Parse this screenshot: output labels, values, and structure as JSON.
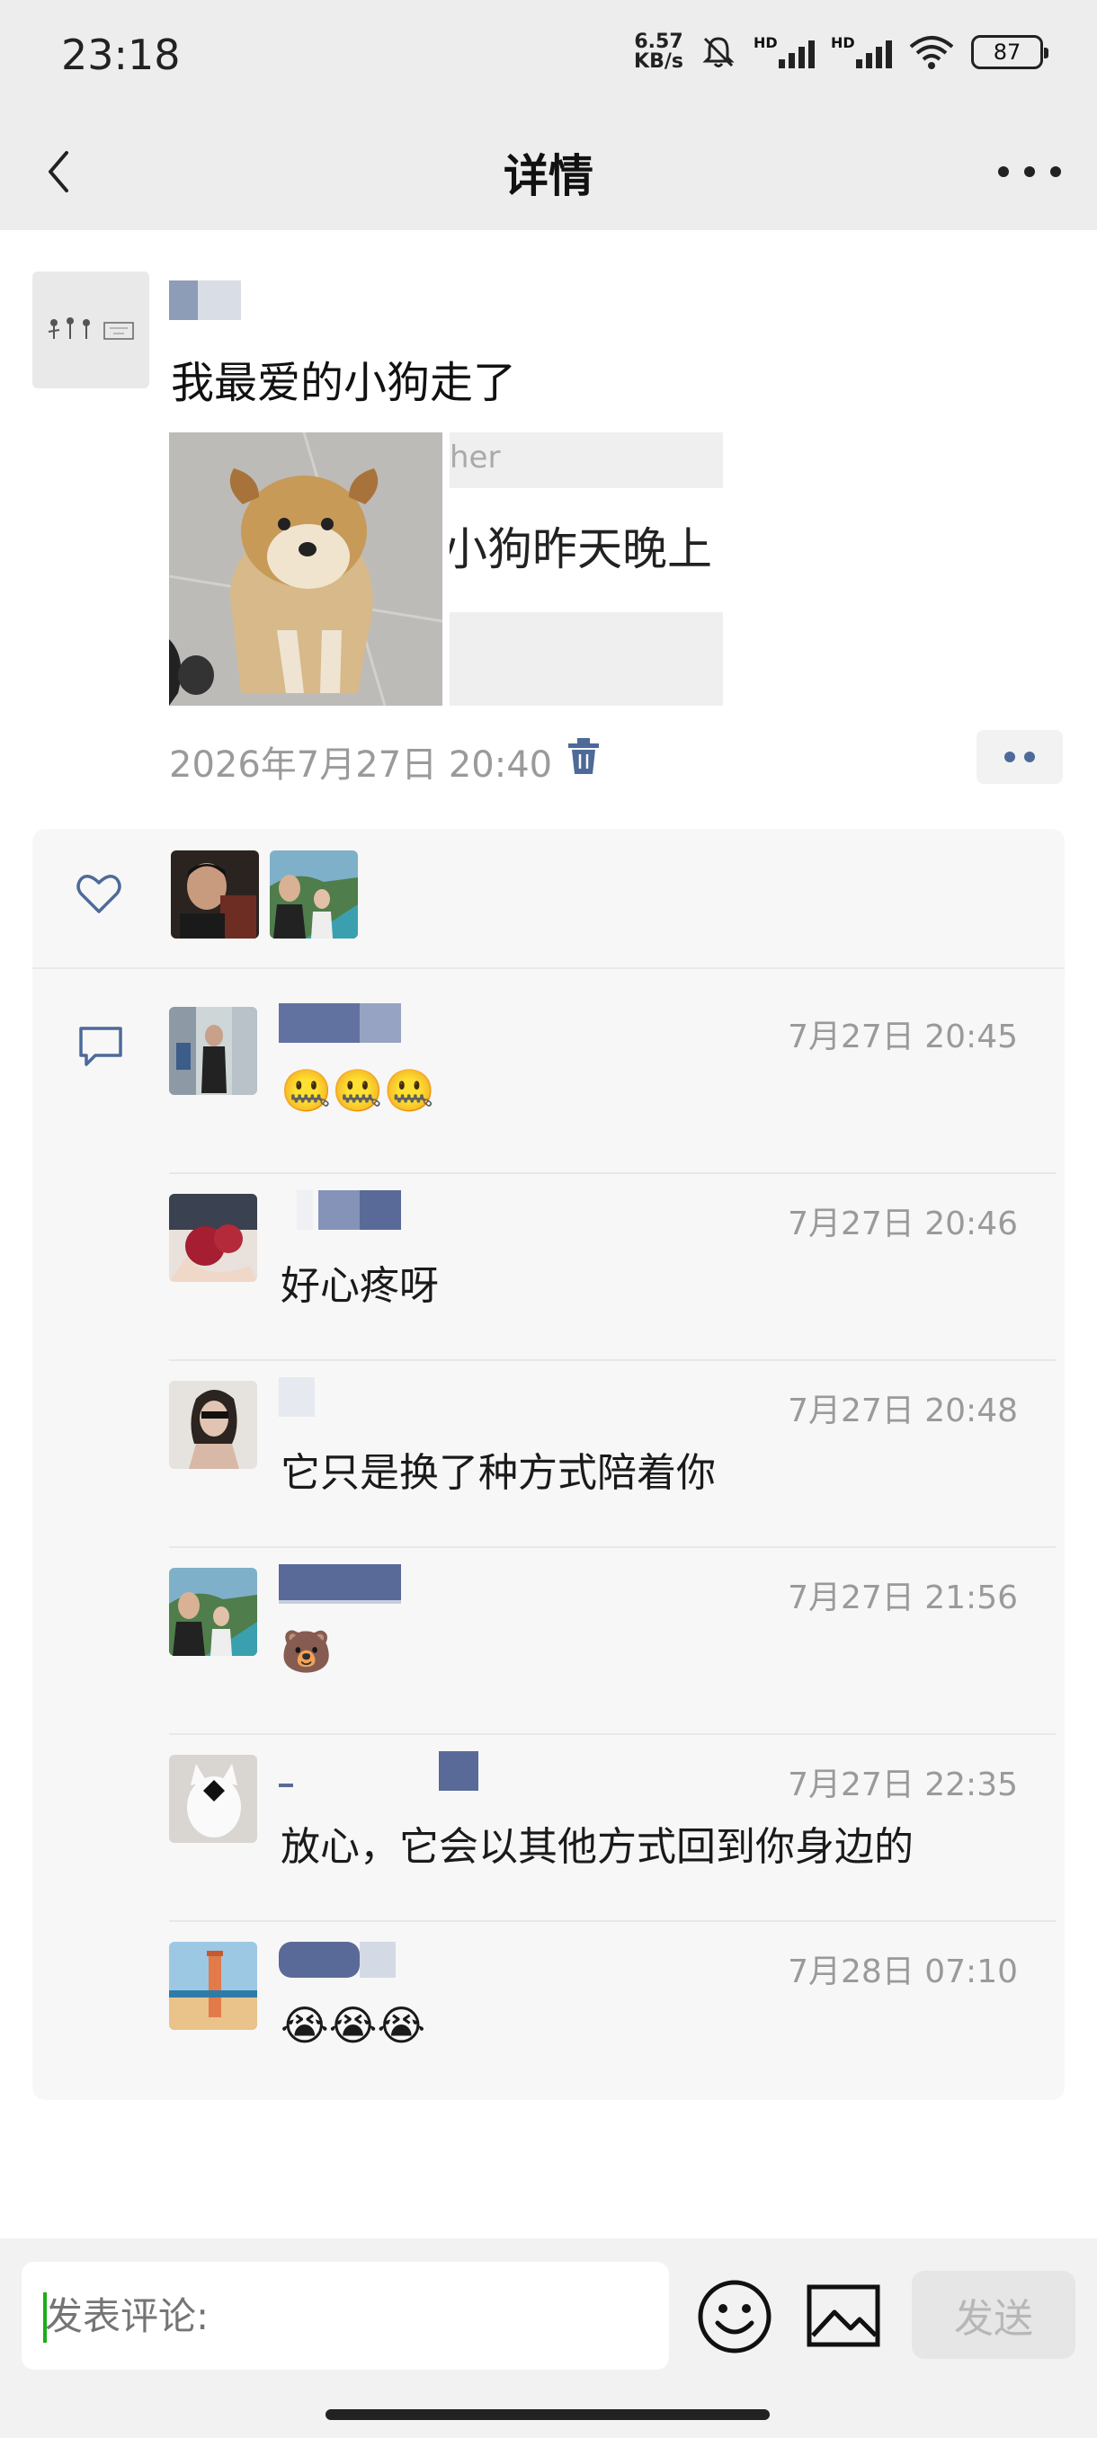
{
  "status_bar": {
    "time": "23:18",
    "net_speed_value": "6.57",
    "net_speed_unit": "KB/s",
    "hd_label_1": "HD",
    "hd_label_2": "HD",
    "battery": "87"
  },
  "nav": {
    "title": "详情"
  },
  "post": {
    "text": "我最爱的小狗走了",
    "share_card_top": "her",
    "share_card_text": "小狗昨天晚上",
    "time": "2026年7月27日 20:40"
  },
  "comments": [
    {
      "time": "7月27日 20:45",
      "text": "",
      "emoji": [
        "🤐",
        "🤐",
        "🤐"
      ]
    },
    {
      "time": "7月27日 20:46",
      "text": "好心疼呀",
      "emoji": []
    },
    {
      "time": "7月27日 20:48",
      "text": "它只是换了种方式陪着你",
      "emoji": []
    },
    {
      "time": "7月27日 21:56",
      "text": "",
      "emoji": [
        "🐻"
      ]
    },
    {
      "time": "7月27日 22:35",
      "text": "放心，它会以其他方式回到你身边的",
      "emoji": []
    },
    {
      "time": "7月28日 07:10",
      "text": "",
      "emoji": [
        "😭",
        "😭",
        "😭"
      ]
    }
  ],
  "input": {
    "placeholder": "发表评论:",
    "send_label": "发送"
  },
  "colors": {
    "accent": "#4d6a99",
    "panel_bg": "#f7f7f7",
    "input_caret": "#1aad19"
  }
}
